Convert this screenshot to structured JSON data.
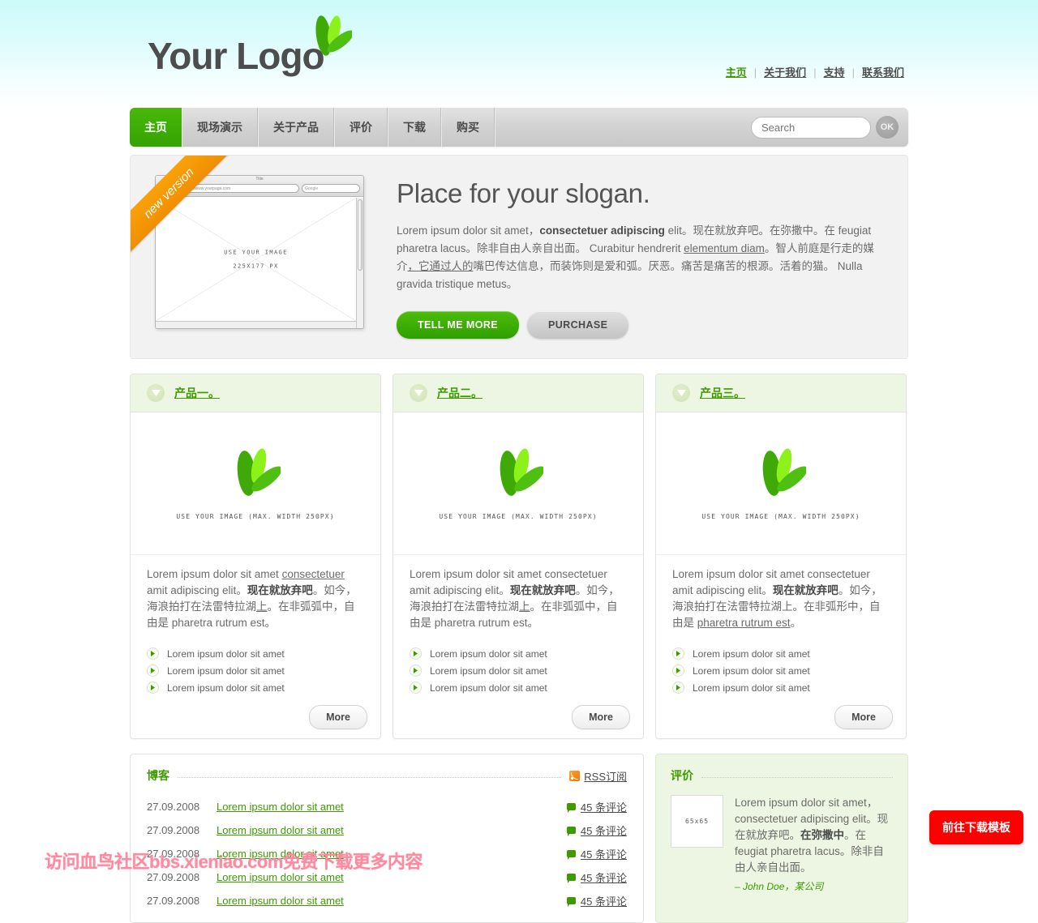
{
  "header": {
    "logo_text": "Your Logo",
    "top_links": [
      {
        "label": "主页",
        "active": true
      },
      {
        "label": "关于我们",
        "active": false
      },
      {
        "label": "支持",
        "active": false
      },
      {
        "label": "联系我们",
        "active": false
      }
    ]
  },
  "nav": {
    "items": [
      {
        "label": "主页",
        "active": true
      },
      {
        "label": "现场演示",
        "active": false
      },
      {
        "label": "关于产品",
        "active": false
      },
      {
        "label": "评价",
        "active": false
      },
      {
        "label": "下载",
        "active": false
      },
      {
        "label": "购买",
        "active": false
      }
    ],
    "search_placeholder": "Search",
    "search_value": "",
    "ok_label": "OK"
  },
  "hero": {
    "ribbon": "new version",
    "browser": {
      "title": "Title",
      "back_label": "◄",
      "forward_label": "+",
      "url": "http://www.yourpage.com",
      "search": "Google"
    },
    "placeholder_line1": "USE YOUR IMAGE",
    "placeholder_line2": "225X177 PX",
    "slogan": "Place for your slogan.",
    "paragraph": {
      "t1": "Lorem ipsum dolor sit amet，",
      "b1": "consectetuer adipiscing",
      "t2": " elit。现在就放弃吧。在弥撒中。在 feugiat pharetra lacus。除非自由人亲自出面。 Curabitur hendrerit ",
      "u1": "elementum diam",
      "t3": "。智人前庭是行走的媒介",
      "u2": "，它通过人的",
      "t4": "嘴巴传达信息，而装饰则是爱和弧。厌恶。痛苦是痛苦的根源。活着的猫。 Nulla gravida tristique metus。"
    },
    "btn_primary": "TELL ME MORE",
    "btn_secondary": "PURCHASE"
  },
  "products": [
    {
      "title": "产品一。",
      "image_caption": "USE YOUR IMAGE (MAX. WIDTH 250PX)",
      "text": {
        "t1": "Lorem ipsum dolor sit amet ",
        "u1": "consectetuer",
        "t2": " amit adipiscing elit。",
        "b1": "现在就放弃吧",
        "t3": "。如今，海浪拍打在法雷特拉湖",
        "u2": "上",
        "t4": "。在非弧弧中，自由是 pharetra rutrum est。"
      },
      "list": [
        "Lorem ipsum dolor sit amet",
        "Lorem ipsum dolor sit amet",
        "Lorem ipsum dolor sit amet"
      ],
      "more_label": "More"
    },
    {
      "title": "产品二。",
      "image_caption": "USE YOUR IMAGE (MAX. WIDTH 250PX)",
      "text": {
        "t1": "Lorem ipsum dolor sit amet consectetuer amit adipiscing elit。",
        "u1": "",
        "t2": "",
        "b1": "现在就放弃吧",
        "t3": "。如今，海浪拍打在法雷特拉湖",
        "u2": "上",
        "t4": "。在非弧弧中，自由是 pharetra rutrum est。"
      },
      "list": [
        "Lorem ipsum dolor sit amet",
        "Lorem ipsum dolor sit amet",
        "Lorem ipsum dolor sit amet"
      ],
      "more_label": "More"
    },
    {
      "title": "产品三。",
      "image_caption": "USE YOUR IMAGE (MAX. WIDTH 250PX)",
      "text": {
        "t1": "Lorem ipsum dolor sit amet consectetuer amit adipiscing elit。",
        "u1": "",
        "t2": "",
        "b1": "现在就放弃吧",
        "t3": "。如今，海浪拍打在法雷特拉湖上。在非弧形中，自由是 ",
        "u2": "pharetra rutrum est",
        "t4": "。"
      },
      "list": [
        "Lorem ipsum dolor sit amet",
        "Lorem ipsum dolor sit amet",
        "Lorem ipsum dolor sit amet"
      ],
      "more_label": "More"
    }
  ],
  "blog": {
    "title": "博客",
    "rss_label": "RSS订阅",
    "rows": [
      {
        "date": "27.09.2008",
        "title": "Lorem ipsum dolor sit amet",
        "comments": "45 条评论"
      },
      {
        "date": "27.09.2008",
        "title": "Lorem ipsum dolor sit amet",
        "comments": "45 条评论"
      },
      {
        "date": "27.09.2008",
        "title": "Lorem ipsum dolor sit amet",
        "comments": "45 条评论"
      },
      {
        "date": "27.09.2008",
        "title": "Lorem ipsum dolor sit amet",
        "comments": "45 条评论"
      },
      {
        "date": "27.09.2008",
        "title": "Lorem ipsum dolor sit amet",
        "comments": "45 条评论"
      }
    ]
  },
  "testimonial": {
    "title": "评价",
    "image_label": "65x65",
    "text": {
      "t1": "Lorem ipsum dolor sit amet，consectetuer adipiscing elit。现在就放弃吧。",
      "b1": "在弥撒中",
      "t2": "。在 feugiat pharetra lacus。除非自由人亲自出面。"
    },
    "author": "– John Doe，某公司"
  },
  "floating": {
    "download_label": "前往下载模板"
  },
  "watermark": "访问血鸟社区bbs.xieniao.com免费下载更多内容",
  "colors": {
    "green": "#3d9b00",
    "green_bright": "#4cbd0b",
    "orange": "#f08f00",
    "red": "#fa0000",
    "bg_cyan": "#cdfafa",
    "panel_grey": "#f2f2f2",
    "panel_green": "#edf6e2"
  }
}
